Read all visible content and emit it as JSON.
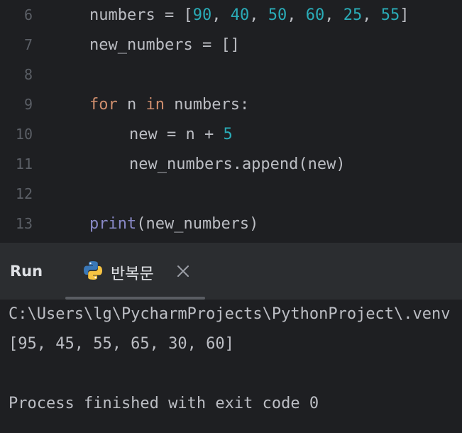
{
  "editor": {
    "lines": [
      {
        "number": "6"
      },
      {
        "number": "7"
      },
      {
        "number": "8"
      },
      {
        "number": "9"
      },
      {
        "number": "10"
      },
      {
        "number": "11"
      },
      {
        "number": "12"
      },
      {
        "number": "13"
      }
    ],
    "code": {
      "line6": {
        "var": "numbers = [",
        "n1": "90",
        "n2": "40",
        "n3": "50",
        "n4": "60",
        "n5": "25",
        "n6": "55",
        "sep": ", ",
        "close": "]"
      },
      "line7": "new_numbers = []",
      "line9": {
        "kw_for": "for",
        "mid": " n ",
        "kw_in": "in",
        "rest": " numbers:"
      },
      "line10": {
        "text": "new = n + ",
        "num": "5"
      },
      "line11": "new_numbers.append(new)",
      "line13": {
        "builtin": "print",
        "rest": "(new_numbers)"
      }
    }
  },
  "run_panel": {
    "title": "Run",
    "tab_label": "반복문",
    "tab_icon": "python-icon",
    "close_icon": "close-icon"
  },
  "console": {
    "lines": [
      "C:\\Users\\lg\\PycharmProjects\\PythonProject\\.venv",
      "[95, 45, 55, 65, 30, 60]",
      "",
      "Process finished with exit code 0"
    ]
  },
  "colors": {
    "background": "#1e1f22",
    "panel": "#2b2d30",
    "text": "#bcbec4",
    "keyword": "#cf8e6d",
    "number": "#2aacb8",
    "builtin": "#8888c6",
    "line_number": "#5b5f66"
  }
}
